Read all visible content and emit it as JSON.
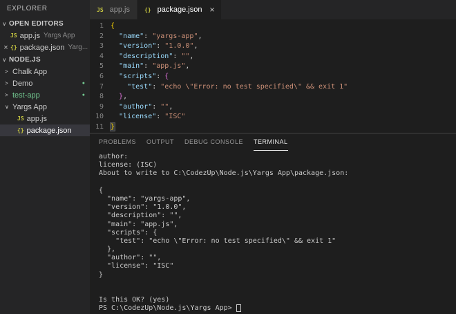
{
  "colors": {
    "editor_bg": "#1e1e1e",
    "sidebar_bg": "#252526",
    "selection_bg": "#37373d",
    "json_key": "#9cdcfe",
    "json_string": "#ce9178",
    "git_green": "#73c991",
    "file_icon_yellow": "#cbcb41"
  },
  "sidebar": {
    "title": "EXPLORER",
    "section_chevron": "∨",
    "open_editors_label": "OPEN EDITORS",
    "open_editors": [
      {
        "close": "",
        "icon": "JS",
        "icon_type": "js",
        "name": "app.js",
        "detail": "Yargs App"
      },
      {
        "close": "×",
        "icon": "{}",
        "icon_type": "json",
        "name": "package.json",
        "detail": "Yarg..."
      }
    ],
    "tree_label": "NODE.JS",
    "tree": [
      {
        "kind": "folder",
        "chevron": ">",
        "name": "Chalk App"
      },
      {
        "kind": "folder",
        "chevron": ">",
        "name": "Demo",
        "dot": "●"
      },
      {
        "kind": "folder",
        "chevron": ">",
        "name": "test-app",
        "dot": "●",
        "green": true
      },
      {
        "kind": "folder",
        "chevron": "∨",
        "name": "Yargs App"
      },
      {
        "kind": "file",
        "icon": "JS",
        "icon_type": "js",
        "name": "app.js"
      },
      {
        "kind": "file",
        "icon": "{}",
        "icon_type": "json",
        "name": "package.json",
        "selected": true
      }
    ]
  },
  "tabs": [
    {
      "icon": "JS",
      "icon_type": "js",
      "label": "app.js",
      "active": false,
      "close": ""
    },
    {
      "icon": "{}",
      "icon_type": "json",
      "label": "package.json",
      "active": true,
      "close": "×"
    }
  ],
  "editor": {
    "lines": [
      {
        "num": "1",
        "tokens": [
          [
            "b1",
            "{"
          ]
        ]
      },
      {
        "num": "2",
        "tokens": [
          [
            "ws",
            "  "
          ],
          [
            "key",
            "\"name\""
          ],
          [
            "pc",
            ": "
          ],
          [
            "str",
            "\"yargs-app\""
          ],
          [
            "pc",
            ","
          ]
        ]
      },
      {
        "num": "3",
        "tokens": [
          [
            "ws",
            "  "
          ],
          [
            "key",
            "\"version\""
          ],
          [
            "pc",
            ": "
          ],
          [
            "str",
            "\"1.0.0\""
          ],
          [
            "pc",
            ","
          ]
        ]
      },
      {
        "num": "4",
        "tokens": [
          [
            "ws",
            "  "
          ],
          [
            "key",
            "\"description\""
          ],
          [
            "pc",
            ": "
          ],
          [
            "str",
            "\"\""
          ],
          [
            "pc",
            ","
          ]
        ]
      },
      {
        "num": "5",
        "tokens": [
          [
            "ws",
            "  "
          ],
          [
            "key",
            "\"main\""
          ],
          [
            "pc",
            ": "
          ],
          [
            "str",
            "\"app.js\""
          ],
          [
            "pc",
            ","
          ]
        ]
      },
      {
        "num": "6",
        "tokens": [
          [
            "ws",
            "  "
          ],
          [
            "key",
            "\"scripts\""
          ],
          [
            "pc",
            ": "
          ],
          [
            "b2",
            "{"
          ]
        ]
      },
      {
        "num": "7",
        "tokens": [
          [
            "ws",
            "    "
          ],
          [
            "key",
            "\"test\""
          ],
          [
            "pc",
            ": "
          ],
          [
            "str",
            "\"echo \\\"Error: no test specified\\\" && exit 1\""
          ]
        ]
      },
      {
        "num": "8",
        "tokens": [
          [
            "ws",
            "  "
          ],
          [
            "b2",
            "}"
          ],
          [
            "pc",
            ","
          ]
        ]
      },
      {
        "num": "9",
        "tokens": [
          [
            "ws",
            "  "
          ],
          [
            "key",
            "\"author\""
          ],
          [
            "pc",
            ": "
          ],
          [
            "str",
            "\"\""
          ],
          [
            "pc",
            ","
          ]
        ]
      },
      {
        "num": "10",
        "tokens": [
          [
            "ws",
            "  "
          ],
          [
            "key",
            "\"license\""
          ],
          [
            "pc",
            ": "
          ],
          [
            "str",
            "\"ISC\""
          ]
        ]
      },
      {
        "num": "11",
        "tokens": [
          [
            "b1m",
            "}"
          ]
        ]
      }
    ]
  },
  "panel": {
    "tabs": [
      {
        "label": "PROBLEMS",
        "active": false
      },
      {
        "label": "OUTPUT",
        "active": false
      },
      {
        "label": "DEBUG CONSOLE",
        "active": false
      },
      {
        "label": "TERMINAL",
        "active": true
      }
    ],
    "terminal": {
      "lines": [
        "author:",
        "license: (ISC)",
        "About to write to C:\\CodezUp\\Node.js\\Yargs App\\package.json:",
        "",
        "{",
        "  \"name\": \"yargs-app\",",
        "  \"version\": \"1.0.0\",",
        "  \"description\": \"\",",
        "  \"main\": \"app.js\",",
        "  \"scripts\": {",
        "    \"test\": \"echo \\\"Error: no test specified\\\" && exit 1\"",
        "  },",
        "  \"author\": \"\",",
        "  \"license\": \"ISC\"",
        "}",
        "",
        "",
        "Is this OK? (yes)"
      ],
      "prompt": "PS C:\\CodezUp\\Node.js\\Yargs App> "
    }
  }
}
